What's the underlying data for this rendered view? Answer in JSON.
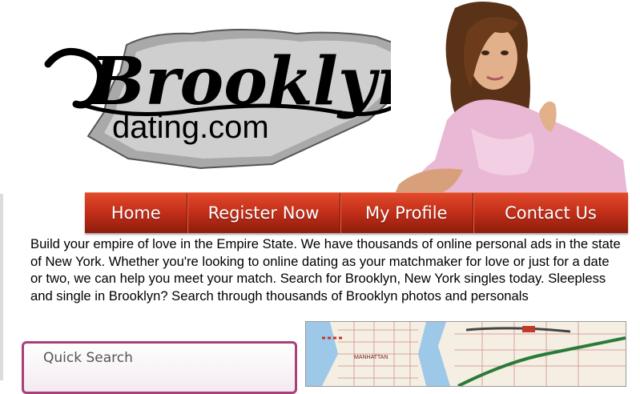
{
  "logo": {
    "wordmark": "Brooklyn",
    "domain": "dating.com"
  },
  "nav": {
    "items": [
      {
        "label": "Home"
      },
      {
        "label": "Register Now"
      },
      {
        "label": "My Profile"
      },
      {
        "label": "Contact Us"
      }
    ]
  },
  "intro": {
    "text": "Build your empire of love in the Empire State. We have thousands of online personal ads in the state of New York. Whether you're looking to online dating as your matchmaker for love or just for a date or two, we can help you meet your match. Search for Brooklyn, New York singles today. Sleepless and single in Brooklyn? Search through thousands of Brooklyn photos and personals"
  },
  "quick_search": {
    "title": "Quick Search"
  },
  "map": {
    "labels": [
      "MANHATTAN"
    ]
  },
  "colors": {
    "nav_red": "#c5301a",
    "quick_search_border": "#a8407a"
  }
}
